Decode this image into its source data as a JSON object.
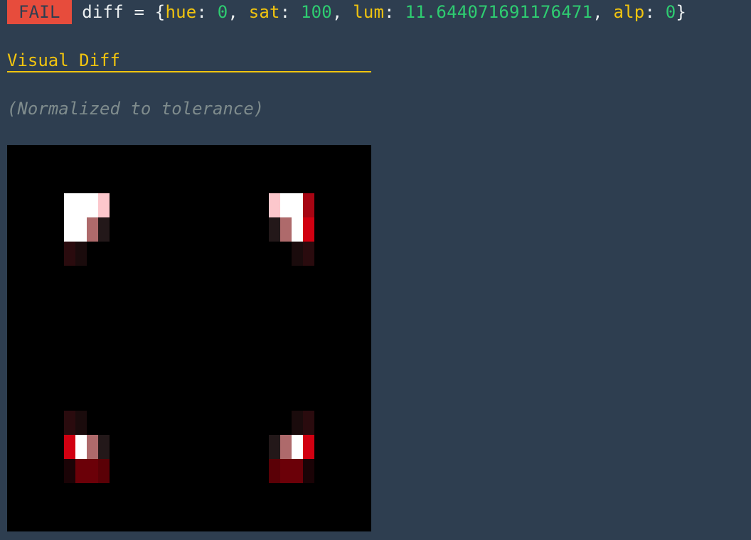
{
  "status": {
    "badge": "FAIL",
    "prefix": " diff = {",
    "hue_key": "hue",
    "hue_value": "0",
    "sat_key": "sat",
    "sat_value": "100",
    "lum_key": "lum",
    "lum_value": "11.644071691176471",
    "alp_key": "alp",
    "alp_value": "0",
    "suffix": "}"
  },
  "section": {
    "heading": "Visual Diff",
    "subtitle": "(Normalized to tolerance)"
  },
  "diff_image": {
    "background": "#000000",
    "grid_columns": 32,
    "grid_rows": 16,
    "pixels": [
      {
        "col": 5,
        "row": 2,
        "color": "#ffffff"
      },
      {
        "col": 6,
        "row": 2,
        "color": "#ffffff"
      },
      {
        "col": 7,
        "row": 2,
        "color": "#ffffff"
      },
      {
        "col": 8,
        "row": 2,
        "color": "#fcc7cc"
      },
      {
        "col": 5,
        "row": 3,
        "color": "#ffffff"
      },
      {
        "col": 6,
        "row": 3,
        "color": "#ffffff"
      },
      {
        "col": 7,
        "row": 3,
        "color": "#ae6a6b"
      },
      {
        "col": 8,
        "row": 3,
        "color": "#231819"
      },
      {
        "col": 5,
        "row": 4,
        "color": "#2a0b0e"
      },
      {
        "col": 6,
        "row": 4,
        "color": "#1a0b0c"
      },
      {
        "col": 23,
        "row": 2,
        "color": "#fcc7cc"
      },
      {
        "col": 24,
        "row": 2,
        "color": "#ffffff"
      },
      {
        "col": 25,
        "row": 2,
        "color": "#ffffff"
      },
      {
        "col": 26,
        "row": 2,
        "color": "#a70513"
      },
      {
        "col": 23,
        "row": 3,
        "color": "#231819"
      },
      {
        "col": 24,
        "row": 3,
        "color": "#ae6a6b"
      },
      {
        "col": 25,
        "row": 3,
        "color": "#ffffff"
      },
      {
        "col": 26,
        "row": 3,
        "color": "#d10011"
      },
      {
        "col": 25,
        "row": 4,
        "color": "#1a0b0c"
      },
      {
        "col": 26,
        "row": 4,
        "color": "#2a0b0e"
      },
      {
        "col": 5,
        "row": 11,
        "color": "#2a0b0e"
      },
      {
        "col": 6,
        "row": 11,
        "color": "#1a0b0c"
      },
      {
        "col": 5,
        "row": 12,
        "color": "#d10011"
      },
      {
        "col": 6,
        "row": 12,
        "color": "#ffffff"
      },
      {
        "col": 7,
        "row": 12,
        "color": "#ae6a6b"
      },
      {
        "col": 8,
        "row": 12,
        "color": "#231819"
      },
      {
        "col": 5,
        "row": 13,
        "color": "#1a0306"
      },
      {
        "col": 6,
        "row": 13,
        "color": "#6b0008"
      },
      {
        "col": 7,
        "row": 13,
        "color": "#6b0008"
      },
      {
        "col": 8,
        "row": 13,
        "color": "#5a0006"
      },
      {
        "col": 25,
        "row": 11,
        "color": "#1a0b0c"
      },
      {
        "col": 26,
        "row": 11,
        "color": "#2a0b0e"
      },
      {
        "col": 23,
        "row": 12,
        "color": "#231819"
      },
      {
        "col": 24,
        "row": 12,
        "color": "#ae6a6b"
      },
      {
        "col": 25,
        "row": 12,
        "color": "#ffffff"
      },
      {
        "col": 26,
        "row": 12,
        "color": "#d10011"
      },
      {
        "col": 23,
        "row": 13,
        "color": "#5a0006"
      },
      {
        "col": 24,
        "row": 13,
        "color": "#6b0008"
      },
      {
        "col": 25,
        "row": 13,
        "color": "#6b0008"
      },
      {
        "col": 26,
        "row": 13,
        "color": "#1a0306"
      }
    ]
  }
}
